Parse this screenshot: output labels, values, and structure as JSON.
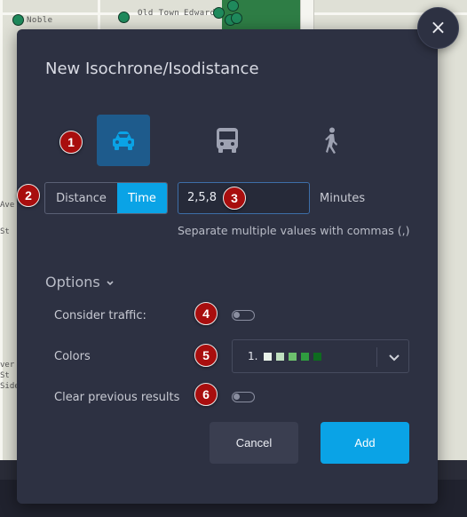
{
  "map": {
    "labels": [
      "Noble",
      "Old Town",
      "Edwards"
    ],
    "side_labels": [
      "Ave",
      "St",
      "St",
      "Side",
      "ver"
    ]
  },
  "dialog": {
    "title": "New Isochrone/Isodistance",
    "close_icon": "×"
  },
  "travel_modes": [
    {
      "name": "car",
      "icon": "car-icon",
      "selected": true
    },
    {
      "name": "transit",
      "icon": "bus-icon",
      "selected": false
    },
    {
      "name": "walking",
      "icon": "walking-person-icon",
      "selected": false
    }
  ],
  "measure": {
    "options": [
      "Distance",
      "Time"
    ],
    "selected": "Time"
  },
  "values_input": {
    "value": "2,5,8",
    "unit": "Minutes",
    "hint": "Separate multiple values with commas (,)"
  },
  "options": {
    "toggle_label": "Options",
    "consider_traffic": {
      "label": "Consider traffic:",
      "on": false
    },
    "colors": {
      "label": "Colors",
      "selected_number": "1.",
      "swatches": [
        "#e9f2e9",
        "#bfe0bf",
        "#6dc16d",
        "#2f9c3f",
        "#0e6b1f"
      ]
    },
    "clear_previous": {
      "label": "Clear previous results",
      "on": false
    }
  },
  "actions": {
    "cancel": "Cancel",
    "add": "Add"
  },
  "annotation_markers": [
    "1",
    "2",
    "3",
    "4",
    "5",
    "6"
  ],
  "colors": {
    "accent": "#0aa3e6",
    "modal_bg": "#2d3142",
    "selected_mode_bg": "#1e5b8c",
    "marker": "#a80e0e"
  }
}
